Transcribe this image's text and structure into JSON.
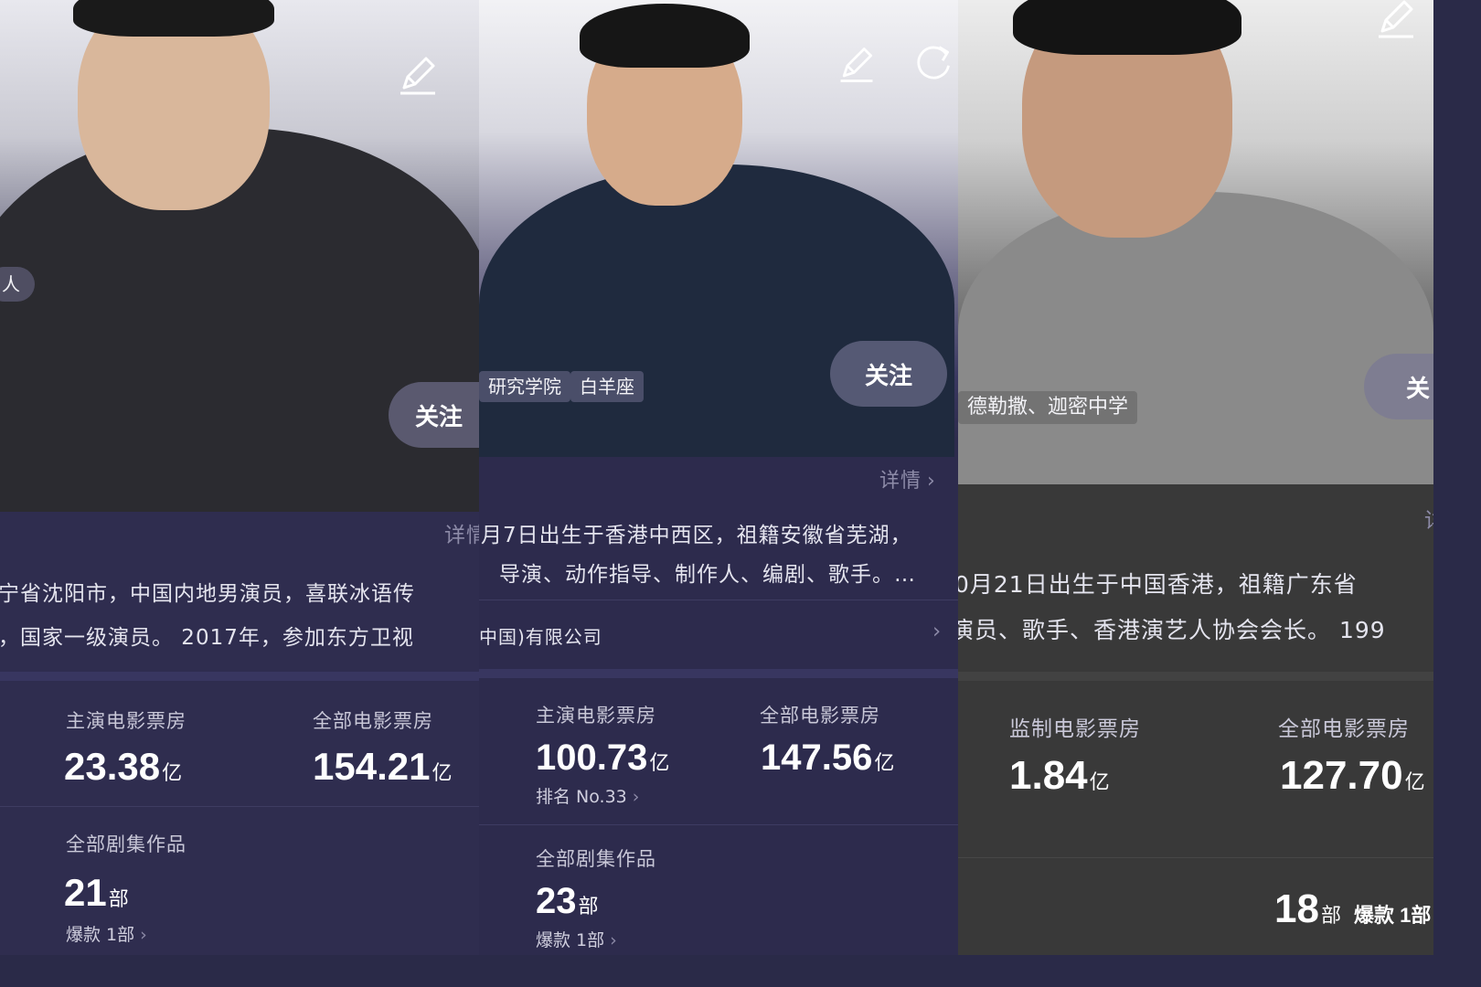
{
  "panels": [
    {
      "follow_label": "关注",
      "tag_fragment": "人",
      "bio_detail_fragment": "详情",
      "bio_line1": "宁省沈阳市，中国内地男演员，喜联冰语传",
      "bio_line2": "，国家一级演员。 2017年，参加东方卫视",
      "stats": [
        {
          "label": "主演电影票房",
          "value": "23.38",
          "unit": "亿"
        },
        {
          "label": "全部电影票房",
          "value": "154.21",
          "unit": "亿"
        }
      ],
      "series": {
        "label": "全部剧集作品",
        "value": "21",
        "unit": "部",
        "hit": "爆款 1部"
      }
    },
    {
      "follow_label": "关注",
      "tags": [
        "研究学院",
        "白羊座"
      ],
      "details_link": "详情",
      "bio_line1": "月7日出生于香港中西区，祖籍安徽省芜湖，",
      "bio_line2": "导演、动作指导、制作人、编剧、歌手。…",
      "company": "中国)有限公司",
      "stats": [
        {
          "label": "主演电影票房",
          "value": "100.73",
          "unit": "亿",
          "rank": "排名 No.33"
        },
        {
          "label": "全部电影票房",
          "value": "147.56",
          "unit": "亿"
        }
      ],
      "series": {
        "label": "全部剧集作品",
        "value": "23",
        "unit": "部",
        "hit": "爆款 1部"
      }
    },
    {
      "follow_label": "关",
      "tag": "德勒撒、迦密中学",
      "details_fragment": "详",
      "bio_line1": "0月21日出生于中国香港，祖籍广东省",
      "bio_line2": "演员、歌手、香港演艺人协会会长。 199",
      "stats": [
        {
          "label": "监制电影票房",
          "value": "1.84",
          "unit": "亿"
        },
        {
          "label": "全部电影票房",
          "value": "127.70",
          "unit": "亿"
        }
      ],
      "series": {
        "value": "18",
        "unit": "部",
        "hit": "爆款 1部"
      }
    }
  ]
}
